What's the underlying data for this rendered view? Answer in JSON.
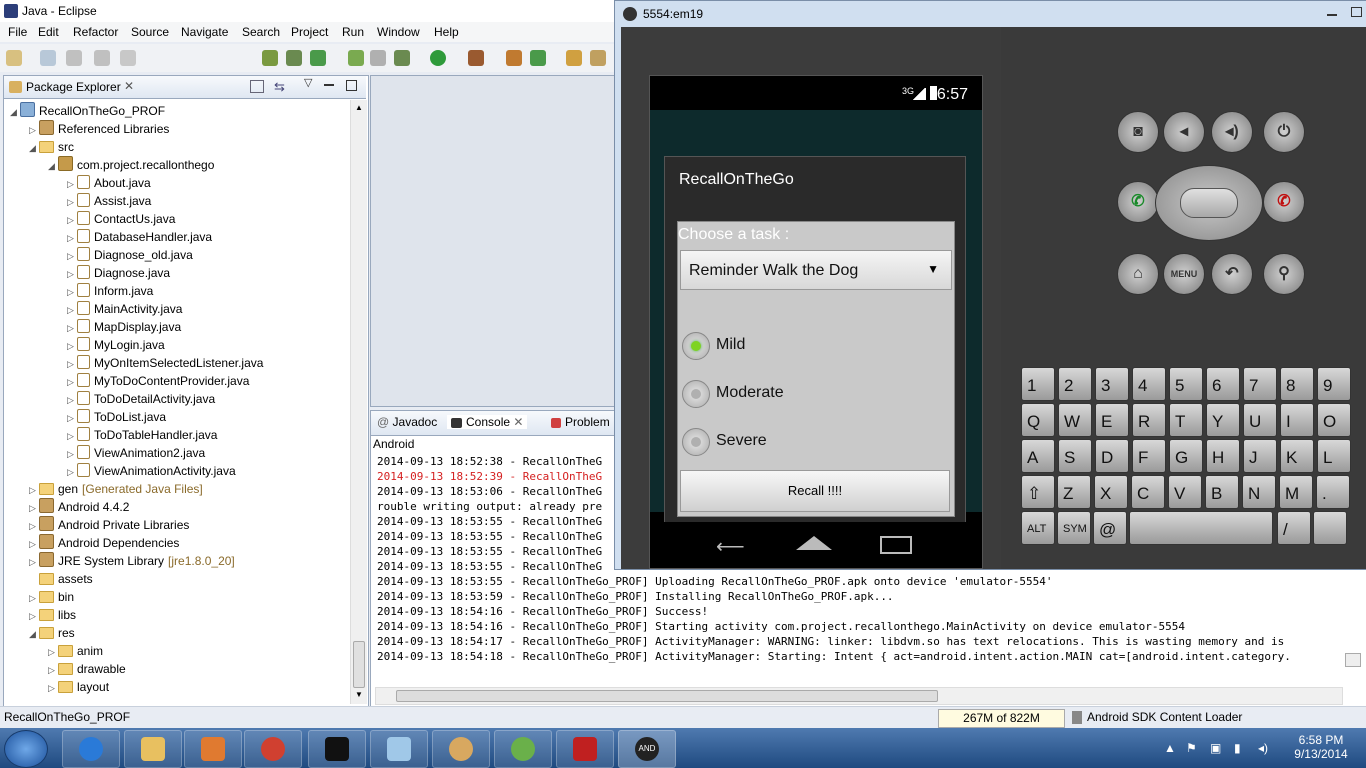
{
  "eclipse": {
    "title": "Java - Eclipse",
    "menu": [
      "File",
      "Edit",
      "Refactor",
      "Source",
      "Navigate",
      "Search",
      "Project",
      "Run",
      "Window",
      "Help"
    ],
    "package_explorer_title": "Package Explorer",
    "tree": [
      {
        "text": "RecallOnTheGo_PROF",
        "extra": ""
      },
      {
        "text": "Referenced Libraries",
        "extra": ""
      },
      {
        "text": "src",
        "extra": ""
      },
      {
        "text": "com.project.recallonthego",
        "extra": ""
      },
      {
        "text": "About.java",
        "extra": ""
      },
      {
        "text": "Assist.java",
        "extra": ""
      },
      {
        "text": "ContactUs.java",
        "extra": ""
      },
      {
        "text": "DatabaseHandler.java",
        "extra": ""
      },
      {
        "text": "Diagnose_old.java",
        "extra": ""
      },
      {
        "text": "Diagnose.java",
        "extra": ""
      },
      {
        "text": "Inform.java",
        "extra": ""
      },
      {
        "text": "MainActivity.java",
        "extra": ""
      },
      {
        "text": "MapDisplay.java",
        "extra": ""
      },
      {
        "text": "MyLogin.java",
        "extra": ""
      },
      {
        "text": "MyOnItemSelectedListener.java",
        "extra": ""
      },
      {
        "text": "MyToDoContentProvider.java",
        "extra": ""
      },
      {
        "text": "ToDoDetailActivity.java",
        "extra": ""
      },
      {
        "text": "ToDoList.java",
        "extra": ""
      },
      {
        "text": "ToDoTableHandler.java",
        "extra": ""
      },
      {
        "text": "ViewAnimation2.java",
        "extra": ""
      },
      {
        "text": "ViewAnimationActivity.java",
        "extra": ""
      },
      {
        "text": "gen",
        "extra": "[Generated Java Files]"
      },
      {
        "text": "Android 4.4.2",
        "extra": ""
      },
      {
        "text": "Android Private Libraries",
        "extra": ""
      },
      {
        "text": "Android Dependencies",
        "extra": ""
      },
      {
        "text": "JRE System Library",
        "extra": "[jre1.8.0_20]"
      },
      {
        "text": "assets",
        "extra": ""
      },
      {
        "text": "bin",
        "extra": ""
      },
      {
        "text": "libs",
        "extra": ""
      },
      {
        "text": "res",
        "extra": ""
      },
      {
        "text": "anim",
        "extra": ""
      },
      {
        "text": "drawable",
        "extra": ""
      },
      {
        "text": "layout",
        "extra": ""
      }
    ],
    "console_tabs": [
      "Javadoc",
      "Console",
      "Problem"
    ],
    "console_header": "Android",
    "console_lines": [
      {
        "text": "2014-09-13 18:52:38 - RecallOnTheG",
        "err": false
      },
      {
        "text": "2014-09-13 18:52:39 - RecallOnTheG",
        "err": true
      },
      {
        "text": "2014-09-13 18:53:06 - RecallOnTheG",
        "err": false
      },
      {
        "text": "rouble writing output: already pre",
        "err": false
      },
      {
        "text": "2014-09-13 18:53:55 - RecallOnTheG",
        "err": false
      },
      {
        "text": "2014-09-13 18:53:55 - RecallOnTheG",
        "err": false
      },
      {
        "text": "2014-09-13 18:53:55 - RecallOnTheG",
        "err": false
      },
      {
        "text": "2014-09-13 18:53:55 - RecallOnTheG",
        "err": false
      },
      {
        "text": "2014-09-13 18:53:55 - RecallOnTheGo_PROF] Uploading RecallOnTheGo_PROF.apk onto device 'emulator-5554'",
        "err": false
      },
      {
        "text": "2014-09-13 18:53:59 - RecallOnTheGo_PROF] Installing RecallOnTheGo_PROF.apk...",
        "err": false
      },
      {
        "text": "2014-09-13 18:54:16 - RecallOnTheGo_PROF] Success!",
        "err": false
      },
      {
        "text": "2014-09-13 18:54:16 - RecallOnTheGo_PROF] Starting activity com.project.recallonthego.MainActivity on device emulator-5554",
        "err": false
      },
      {
        "text": "2014-09-13 18:54:17 - RecallOnTheGo_PROF] ActivityManager: WARNING: linker: libdvm.so has text relocations. This is wasting memory and is",
        "err": false
      },
      {
        "text": "2014-09-13 18:54:18 - RecallOnTheGo_PROF] ActivityManager: Starting: Intent { act=android.intent.action.MAIN cat=[android.intent.category.",
        "err": false
      }
    ],
    "status_left": "RecallOnTheGo_PROF",
    "heap": "267M of 822M",
    "sdk_loader": "Android SDK Content Loader"
  },
  "emulator": {
    "title": "5554:em19",
    "clock": "6:57",
    "signal": "3G",
    "dialog_title": "RecallOnTheGo",
    "choose_label": "Choose a task :",
    "spinner_value": "Reminder Walk the Dog",
    "radios": [
      {
        "label": "Mild",
        "checked": true
      },
      {
        "label": "Moderate",
        "checked": false
      },
      {
        "label": "Severe",
        "checked": false
      }
    ],
    "recall_button": "Recall !!!!",
    "menu_label": "MENU",
    "keyboard_rows": [
      [
        "1",
        "2",
        "3",
        "4",
        "5",
        "6",
        "7",
        "8",
        "9"
      ],
      [
        "Q",
        "W",
        "E",
        "R",
        "T",
        "Y",
        "U",
        "I",
        "O"
      ],
      [
        "A",
        "S",
        "D",
        "F",
        "G",
        "H",
        "J",
        "K",
        "L"
      ],
      [
        "Z",
        "X",
        "C",
        "V",
        "B",
        "N",
        "M",
        "."
      ]
    ],
    "key_alt": "ALT",
    "key_sym": "SYM",
    "key_at": "@",
    "key_slash": "/"
  },
  "taskbar": {
    "time": "6:58 PM",
    "date": "9/13/2014",
    "and_label": "AND"
  }
}
